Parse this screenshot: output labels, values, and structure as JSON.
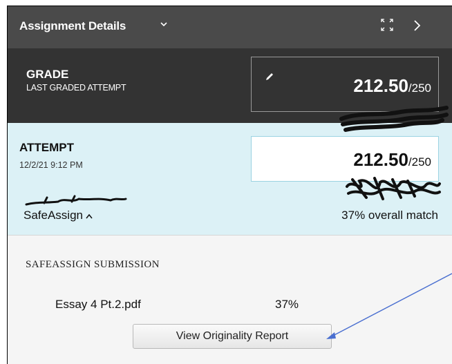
{
  "header": {
    "title": "Assignment Details",
    "chevron_icon": "chevron-down-icon",
    "expand_icon": "expand-icon",
    "next_icon": "chevron-right-icon"
  },
  "grade": {
    "label": "GRADE",
    "sublabel": "LAST GRADED ATTEMPT",
    "score": "212.50",
    "max": "/250",
    "edit_icon": "pencil-icon"
  },
  "attempt": {
    "label": "ATTEMPT",
    "date": "12/2/21 9:12 PM",
    "score": "212.50",
    "max": "/250"
  },
  "safeassign": {
    "toggle_label": "SafeAssign",
    "overall_match": "37% overall match"
  },
  "submission": {
    "title": "SAFEASSIGN SUBMISSION",
    "file_name": "Essay 4 Pt.2.pdf",
    "file_match": "37%",
    "report_button": "View Originality Report"
  },
  "colors": {
    "header_bg": "#4a4a4a",
    "grade_bg": "#333333",
    "attempt_bg": "#dcf1f6",
    "annotation_arrow": "#4a6fd0"
  }
}
